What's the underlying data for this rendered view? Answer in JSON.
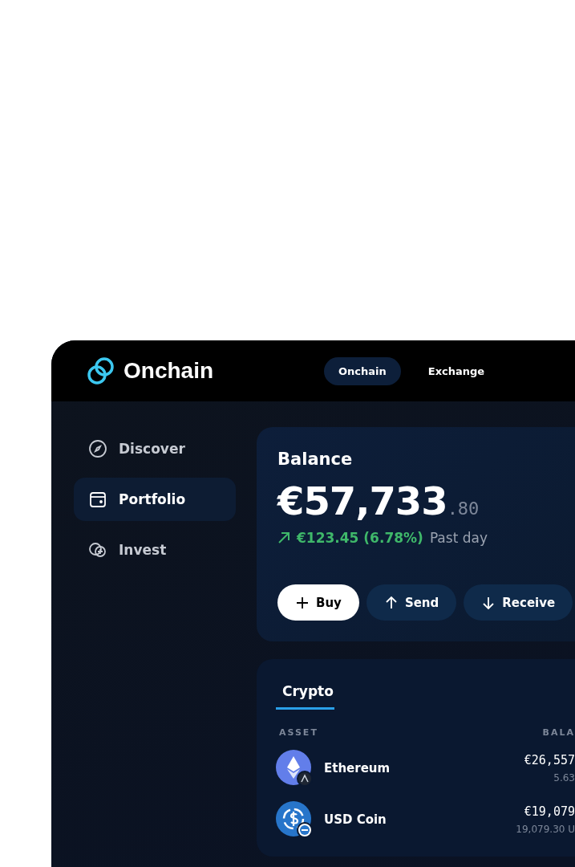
{
  "app": {
    "name": "Onchain"
  },
  "nav_tabs": [
    {
      "label": "Onchain",
      "selected": true
    },
    {
      "label": "Exchange",
      "selected": false
    }
  ],
  "sidebar": {
    "items": [
      {
        "label": "Discover",
        "kind": "compass",
        "selected": false
      },
      {
        "label": "Portfolio",
        "kind": "wallet",
        "selected": true
      },
      {
        "label": "Invest",
        "kind": "coins",
        "selected": false
      }
    ]
  },
  "balance": {
    "title": "Balance",
    "amount": "€57,733",
    "cents": ".80",
    "change": "€123.45 (6.78%)",
    "period": "Past day",
    "actions": [
      {
        "label": "Buy",
        "kind": "plus",
        "primary": true
      },
      {
        "label": "Send",
        "kind": "up",
        "primary": false
      },
      {
        "label": "Receive",
        "kind": "down",
        "primary": false
      }
    ]
  },
  "holdings": {
    "tabs": [
      {
        "label": "Crypto",
        "selected": true
      }
    ],
    "columns": [
      "ASSET",
      "BALA"
    ],
    "rows": [
      {
        "name": "Ethereum",
        "kind": "eth",
        "value": "€26,557",
        "amount": "5.63"
      },
      {
        "name": "USD Coin",
        "kind": "usdc",
        "value": "€19,079",
        "amount": "19,079.30 U"
      }
    ]
  }
}
